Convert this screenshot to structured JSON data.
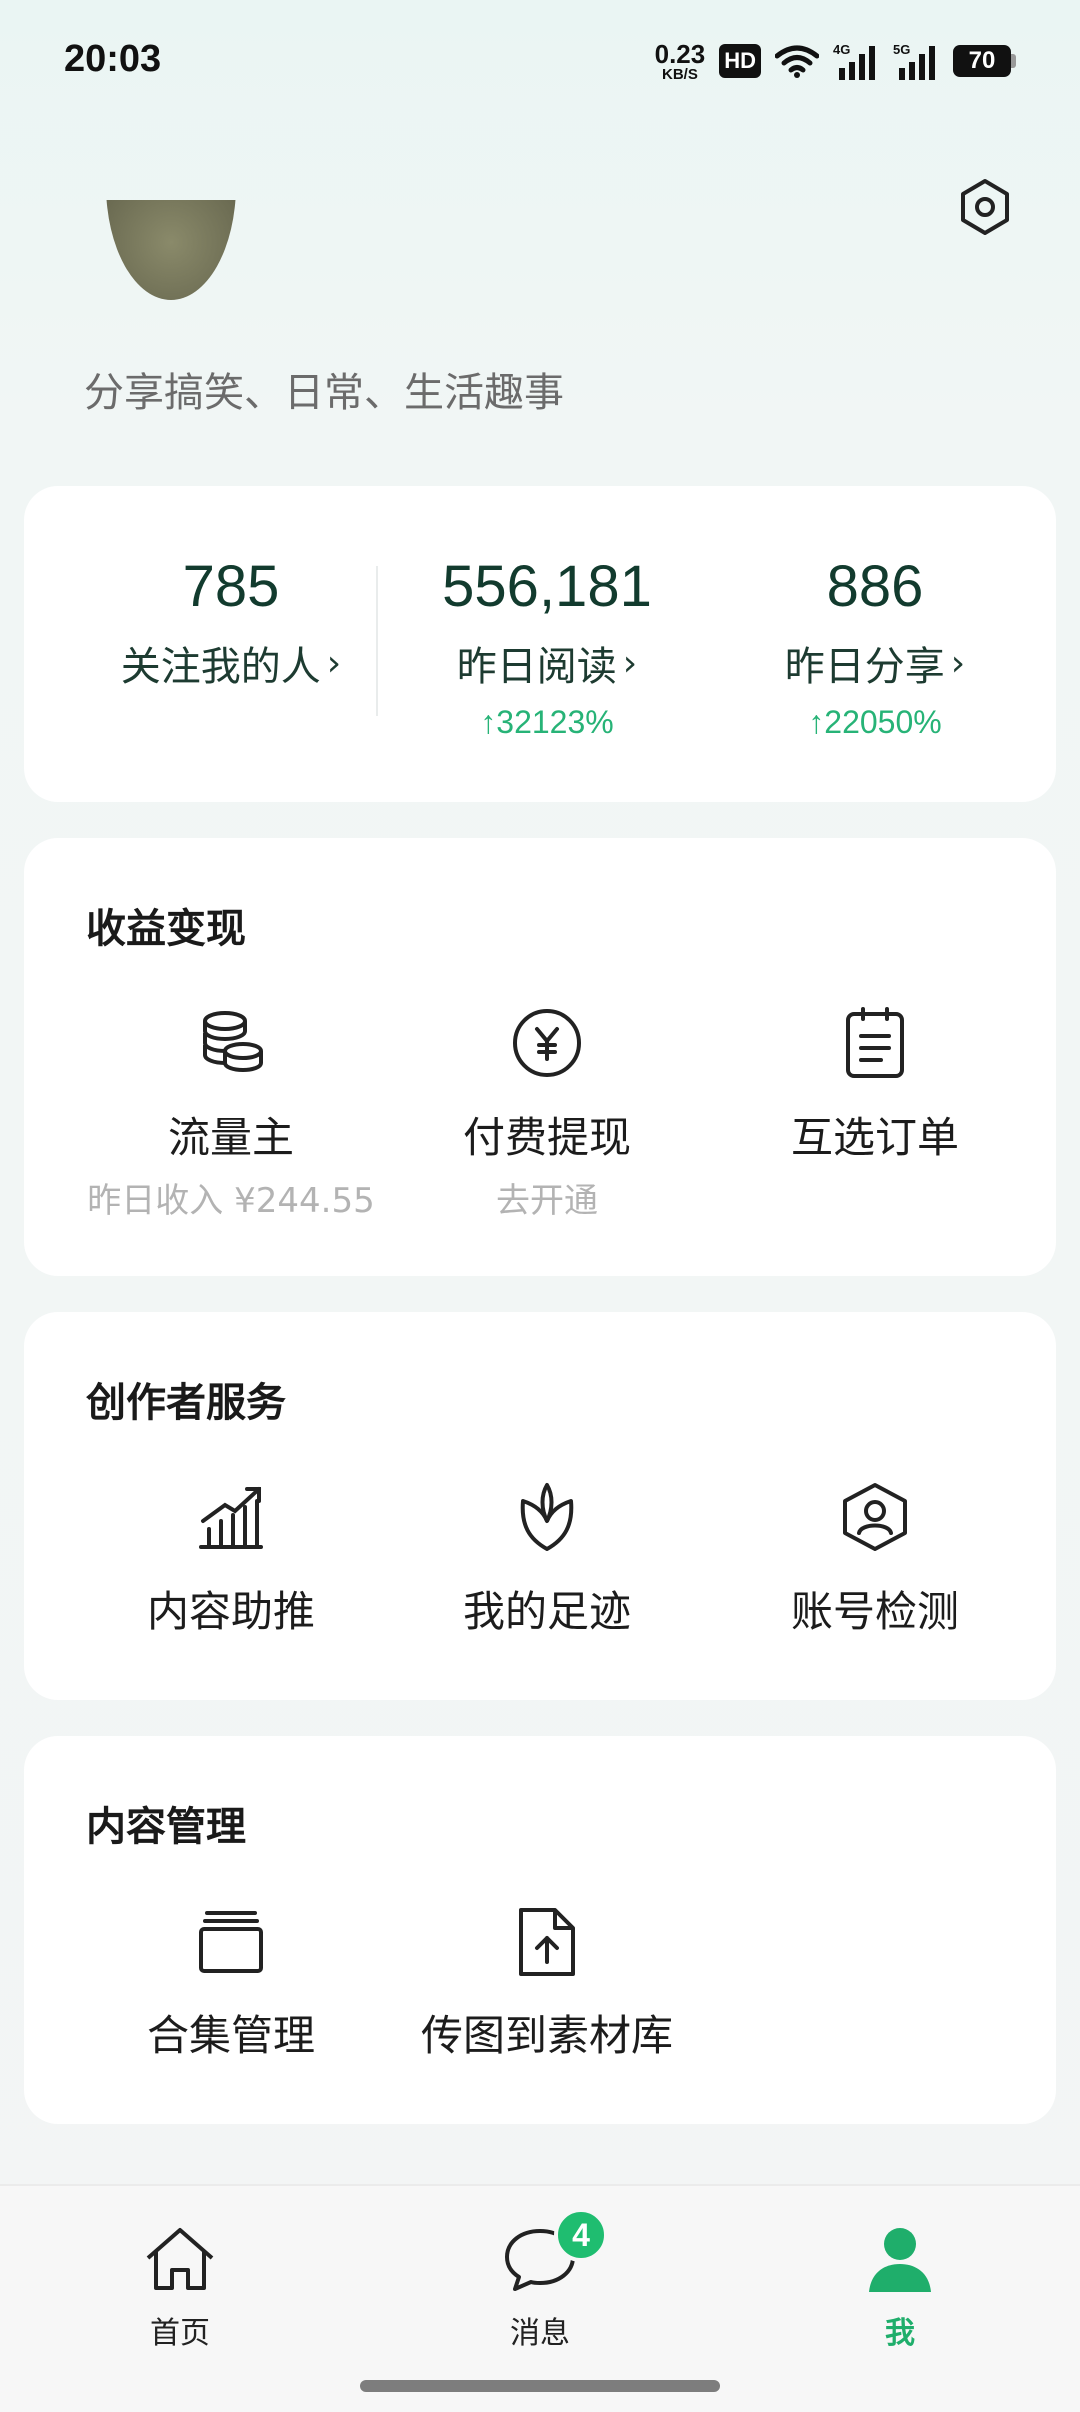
{
  "status_bar": {
    "time": "20:03",
    "net_speed_value": "0.23",
    "net_speed_unit": "KB/S",
    "hd_label": "HD",
    "battery": "70"
  },
  "profile": {
    "bio": "分享搞笑、日常、生活趣事"
  },
  "stats": [
    {
      "value": "785",
      "label": "关注我的人",
      "growth": ""
    },
    {
      "value": "556,181",
      "label": "昨日阅读",
      "growth": "↑32123%"
    },
    {
      "value": "886",
      "label": "昨日分享",
      "growth": "↑22050%"
    }
  ],
  "revenue": {
    "title": "收益变现",
    "items": [
      {
        "label": "流量主",
        "sub": "昨日收入 ¥244.55",
        "icon": "coins-icon"
      },
      {
        "label": "付费提现",
        "sub": "去开通",
        "icon": "yuan-circle-icon"
      },
      {
        "label": "互选订单",
        "sub": "",
        "icon": "clipboard-icon"
      }
    ]
  },
  "creator": {
    "title": "创作者服务",
    "items": [
      {
        "label": "内容助推",
        "icon": "growth-chart-icon"
      },
      {
        "label": "我的足迹",
        "icon": "leaf-icon"
      },
      {
        "label": "账号检测",
        "icon": "user-shield-icon"
      }
    ]
  },
  "content": {
    "title": "内容管理",
    "items": [
      {
        "label": "合集管理",
        "icon": "collection-icon"
      },
      {
        "label": "传图到素材库",
        "icon": "upload-file-icon"
      }
    ]
  },
  "tabbar": {
    "items": [
      {
        "label": "首页",
        "icon": "home-icon"
      },
      {
        "label": "消息",
        "icon": "chat-icon",
        "badge": "4"
      },
      {
        "label": "我",
        "icon": "person-icon",
        "active": true
      }
    ]
  },
  "colors": {
    "accent_green": "#1fae6b",
    "growth_green": "#27b377",
    "stat_number": "#123b2e"
  }
}
